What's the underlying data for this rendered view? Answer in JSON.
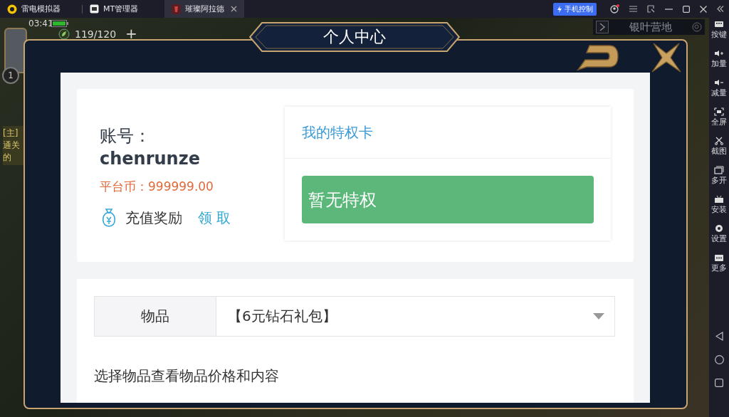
{
  "tabs": [
    {
      "label": "雷电模拟器",
      "kind": "logo",
      "selected": false
    },
    {
      "label": "MT管理器",
      "kind": "app",
      "selected": false
    },
    {
      "label": "璀璨阿拉德",
      "kind": "game",
      "selected": true
    }
  ],
  "title_bar": {
    "control_button": "手机控制"
  },
  "game_hud": {
    "time": "03:41",
    "level": "1",
    "stamina": "119/120",
    "plus": "+",
    "location": "银叶营地",
    "quest_lines": [
      "[主]",
      "通关",
      "的"
    ]
  },
  "dialog": {
    "title": "个人中心",
    "account_label": "账号：",
    "account": "chenrunze",
    "balance": "平台币：999999.00",
    "reward_label": "充值奖励",
    "reward_action": "领 取",
    "privilege_title": "我的特权卡",
    "privilege_status": "暂无特权",
    "item_label": "物品",
    "item_value": "【6元钻石礼包】",
    "hint": "选择物品查看物品价格和内容"
  },
  "sidebar": [
    {
      "label": "按键",
      "kind": "keys"
    },
    {
      "label": "加量",
      "kind": "volume-up"
    },
    {
      "label": "减量",
      "kind": "volume-down"
    },
    {
      "label": "全屏",
      "kind": "fullscreen"
    },
    {
      "label": "截图",
      "kind": "scissors"
    },
    {
      "label": "多开",
      "kind": "multi"
    },
    {
      "label": "安装",
      "kind": "apk"
    },
    {
      "label": "设置",
      "kind": "settings"
    },
    {
      "label": "更多",
      "kind": "more"
    }
  ]
}
